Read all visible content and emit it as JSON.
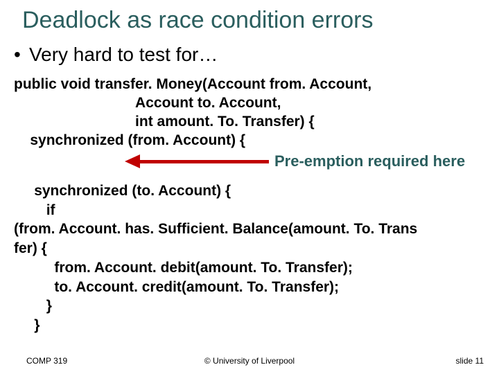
{
  "title": "Deadlock as race condition errors",
  "bullet": "Very hard to test for…",
  "code_block1": "public void transfer. Money(Account from. Account,\n                              Account to. Account,\n                              int amount. To. Transfer) {\n    synchronized (from. Account) {",
  "annotation": "Pre-emption required here",
  "code_block2": "     synchronized (to. Account) {\n        if\n(from. Account. has. Sufficient. Balance(amount. To. Trans\nfer) {\n          from. Account. debit(amount. To. Transfer);\n          to. Account. credit(amount. To. Transfer);\n        }\n     }",
  "footer": {
    "left": "COMP 319",
    "center": "© University of Liverpool",
    "right_prefix": "slide ",
    "right_num": "11"
  }
}
